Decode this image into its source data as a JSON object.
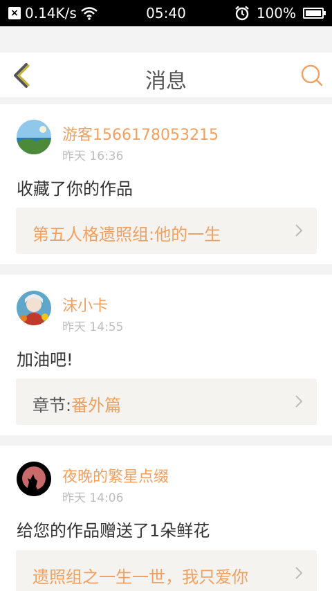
{
  "status_bar": {
    "speed": "0.14K/s",
    "time": "05:40",
    "battery": "100%",
    "battery_level": 1.0
  },
  "header": {
    "title": "消息"
  },
  "messages": [
    {
      "user": "游客1566178053215",
      "time": "昨天 16:36",
      "text": "收藏了你的作品",
      "link_prefix": "",
      "link_text": "第五人格遗照组:他的一生"
    },
    {
      "user": "沫小卡",
      "time": "昨天 14:55",
      "text": "加油吧!",
      "link_prefix": "章节:",
      "link_text": "番外篇"
    },
    {
      "user": "夜晚的繁星点缀",
      "time": "昨天 14:06",
      "text": "给您的作品赠送了1朵鲜花",
      "link_prefix": "",
      "link_text": "遗照组之一生一世，我只爱你"
    }
  ],
  "colors": {
    "accent": "#f0a060",
    "back_icon": "#c8b030",
    "background": "#f3f3f3"
  }
}
